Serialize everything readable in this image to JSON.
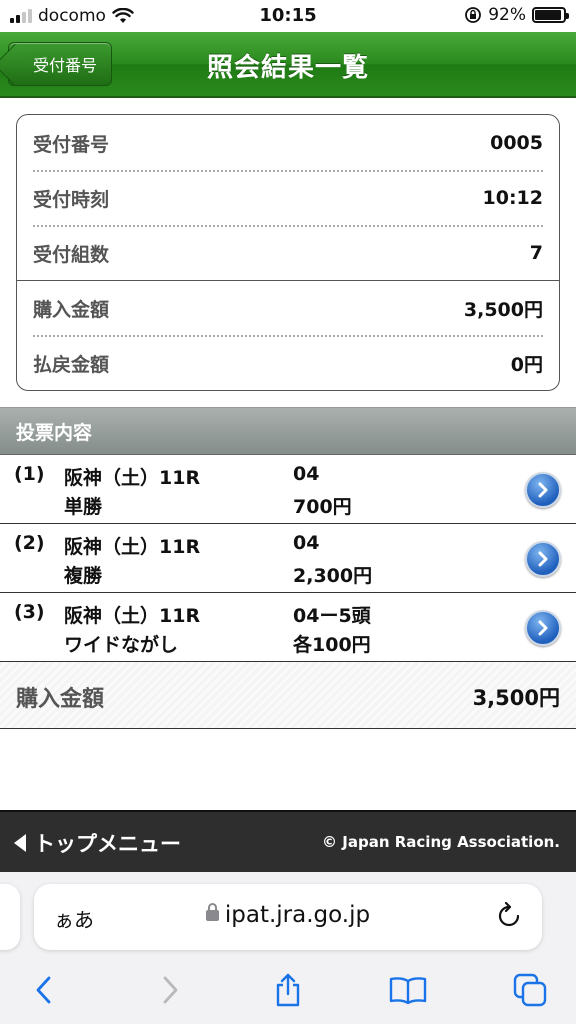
{
  "status": {
    "carrier": "docomo",
    "time": "10:15",
    "battery": "92%",
    "battery_level": 0.92
  },
  "header": {
    "back_label": "受付番号",
    "title": "照会結果一覧"
  },
  "summary": {
    "rows": [
      {
        "label": "受付番号",
        "value": "0005"
      },
      {
        "label": "受付時刻",
        "value": "10:12"
      },
      {
        "label": "受付組数",
        "value": "7"
      },
      {
        "label": "購入金額",
        "value": "3,500円"
      },
      {
        "label": "払戻金額",
        "value": "0円"
      }
    ]
  },
  "bets": {
    "section_title": "投票内容",
    "items": [
      {
        "num": "(1)",
        "race": "阪神（土）11R",
        "type": "単勝",
        "selection": "04",
        "amount": "700円"
      },
      {
        "num": "(2)",
        "race": "阪神（土）11R",
        "type": "複勝",
        "selection": "04",
        "amount": "2,300円"
      },
      {
        "num": "(3)",
        "race": "阪神（土）11R",
        "type": "ワイドながし",
        "selection": "04ー5頭",
        "amount": "各100円"
      }
    ]
  },
  "total": {
    "label": "購入金額",
    "value": "3,500円"
  },
  "footer": {
    "top_menu": "トップメニュー",
    "copyright": "© Japan Racing Association."
  },
  "browser": {
    "aa": "ぁあ",
    "url": "ipat.jra.go.jp",
    "accent": "#1a73e8"
  }
}
